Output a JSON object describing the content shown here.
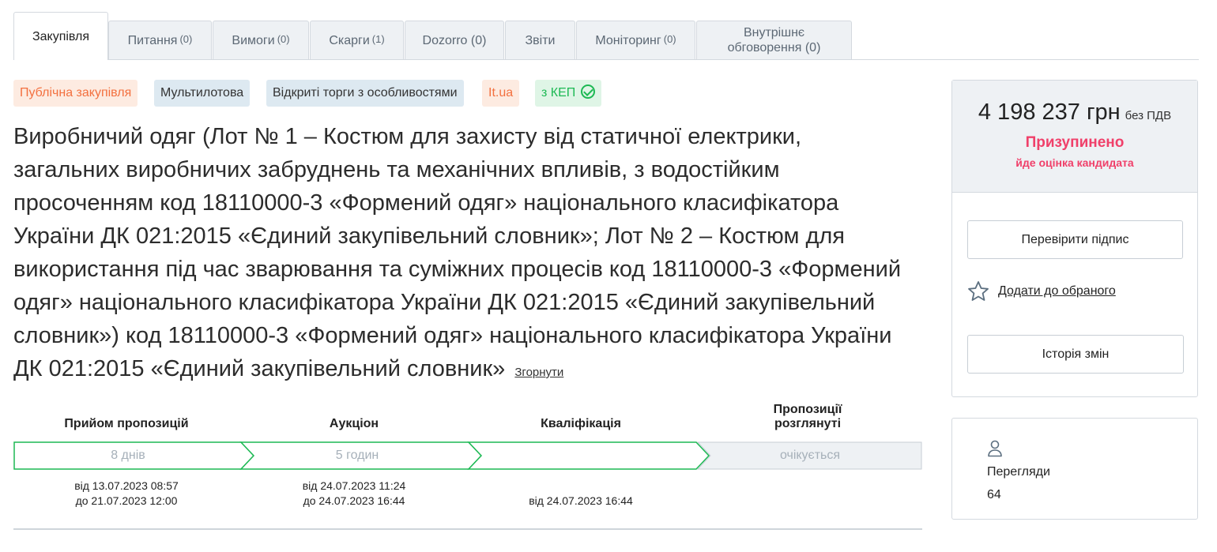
{
  "tabs": [
    {
      "label": "Закупівля",
      "count": ""
    },
    {
      "label": "Питання",
      "count": "(0)"
    },
    {
      "label": "Вимоги",
      "count": "(0)"
    },
    {
      "label": "Скарги",
      "count": "(1)"
    },
    {
      "label": "Dozorro (0)",
      "count": ""
    },
    {
      "label": "Звіти",
      "count": ""
    },
    {
      "label": "Моніторинг",
      "count": "(0)"
    },
    {
      "label": "Внутрішнє обговорення (0)",
      "count": ""
    }
  ],
  "badges": {
    "public": "Публічна закупівля",
    "multilot": "Мультилотова",
    "procedure": "Відкриті торги з особливостями",
    "platform": "It.ua",
    "kep": "з КЕП"
  },
  "title": "Виробничий одяг (Лот № 1 – Костюм для захисту від статичної електрики, загальних виробничих забруднень та механічних впливів, з водостійким просоченням код 18110000-3 «Формений одяг» національного класифікатора України ДК 021:2015 «Єдиний закупівельний словник»; Лот № 2 – Костюм для використання під час зварювання та суміжних процесів код 18110000-3 «Формений одяг» національного класифікатора України ДК 021:2015 «Єдиний закупівельний словник») код 18110000-3 «Формений одяг» національного класифікатора України ДК 021:2015 «Єдиний закупівельний словник»",
  "collapse_label": "Згорнути",
  "timeline": {
    "stages": [
      {
        "label": "Прийом пропозицій",
        "duration": "8 днів",
        "date_from": "від 13.07.2023 08:57",
        "date_to": "до 21.07.2023 12:00"
      },
      {
        "label": "Аукціон",
        "duration": "5 годин",
        "date_from": "від 24.07.2023 11:24",
        "date_to": "до 24.07.2023 16:44"
      },
      {
        "label": "Кваліфікація",
        "duration": "",
        "date_from": "від 24.07.2023 16:44",
        "date_to": ""
      },
      {
        "label": "Пропозиції розглянуті",
        "duration": "очікується",
        "date_from": "",
        "date_to": ""
      }
    ],
    "colors": {
      "done": "#1db954",
      "pending_fill": "#eef1f4",
      "pending_border": "#c7ced5"
    }
  },
  "panel": {
    "amount": "4 198 237 грн",
    "vat": "без ПДВ",
    "status": "Призупинено",
    "substatus": "йде оцінка кандидата",
    "verify_button": "Перевірити підпис",
    "favorite_label": "Додати до обраного",
    "history_button": "Історія змін"
  },
  "views": {
    "label": "Перегляди",
    "count": "64"
  },
  "icons": {
    "check": "check-circle-icon",
    "star": "star-outline-icon",
    "user": "user-outline-icon"
  }
}
